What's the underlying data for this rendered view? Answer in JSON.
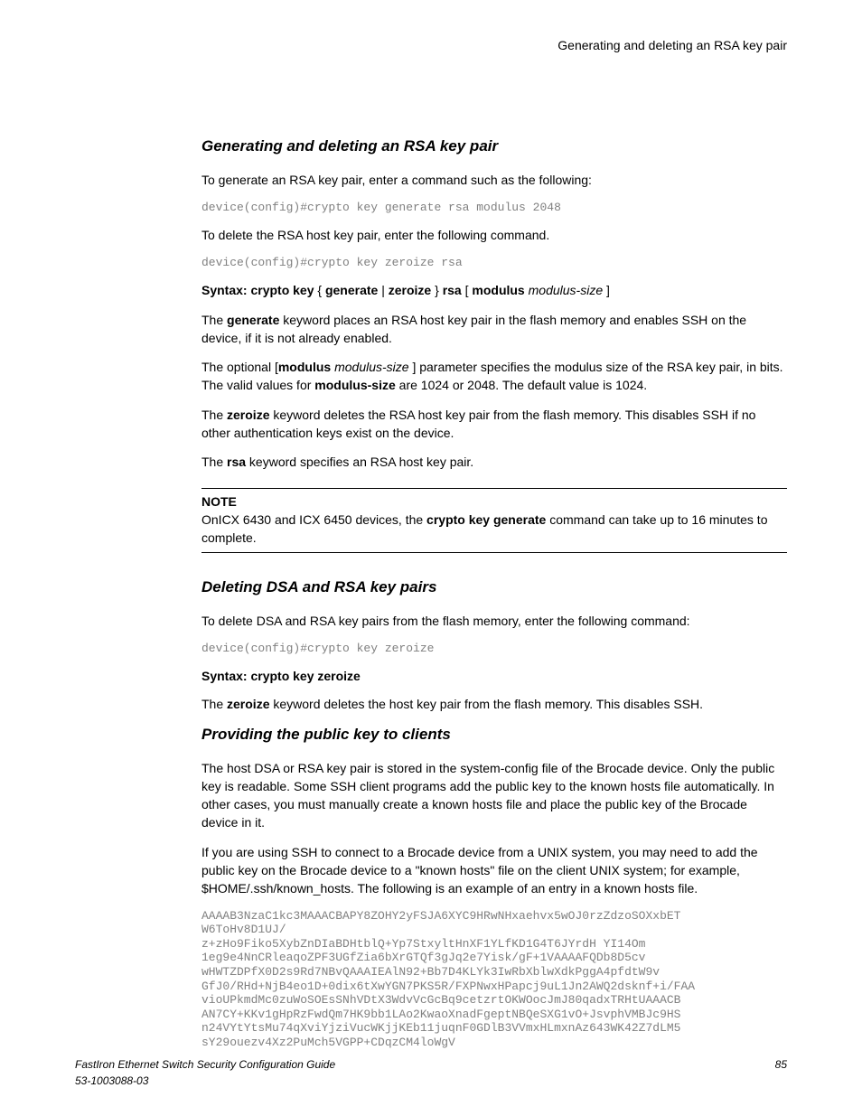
{
  "header": {
    "running": "Generating and deleting an RSA key pair"
  },
  "sections": {
    "s1": {
      "heading": "Generating and deleting an RSA key pair",
      "p1": "To generate an RSA key pair, enter a command such as the following:",
      "code1": "device(config)#crypto key generate rsa modulus 2048",
      "p2": "To delete the RSA host key pair, enter the following command.",
      "code2": "device(config)#crypto key zeroize rsa",
      "syntax_prefix": "Syntax: crypto key",
      "syntax_brace_open": " { ",
      "syntax_generate": "generate",
      "syntax_pipe": " | ",
      "syntax_zeroize": "zeroize",
      "syntax_brace_close": " } ",
      "syntax_rsa": "rsa",
      "syntax_bracket_open": " [ ",
      "syntax_modulus": "modulus",
      "syntax_space": " ",
      "syntax_modsize": "modulus-size",
      "syntax_bracket_close": " ]",
      "p3_a": "The ",
      "p3_b": "generate",
      "p3_c": " keyword places an RSA host key pair in the flash memory and enables SSH on the device, if it is not already enabled.",
      "p4_a": "The optional [",
      "p4_b": "modulus",
      "p4_c": " ",
      "p4_d": "modulus-size",
      "p4_e": " ] parameter specifies the modulus size of the RSA key pair, in bits. The valid values for ",
      "p4_f": "modulus-size",
      "p4_g": " are 1024 or 2048. The default value is 1024.",
      "p5_a": "The ",
      "p5_b": "zeroize",
      "p5_c": " keyword deletes the RSA host key pair from the flash memory. This disables SSH if no other authentication keys exist on the device.",
      "p6_a": "The ",
      "p6_b": "rsa",
      "p6_c": " keyword specifies an RSA host key pair.",
      "note_label": "NOTE",
      "note_a": "OnICX 6430 and ICX 6450 devices, the ",
      "note_b": "crypto key generate",
      "note_c": " command can take up to 16 minutes to complete."
    },
    "s2": {
      "heading": "Deleting DSA and RSA key pairs",
      "p1": "To delete DSA and RSA key pairs from the flash memory, enter the following command:",
      "code1": "device(config)#crypto key zeroize",
      "syntax": "Syntax: crypto key zeroize",
      "p2_a": "The ",
      "p2_b": "zeroize",
      "p2_c": " keyword deletes the host key pair from the flash memory. This disables SSH."
    },
    "s3": {
      "heading": "Providing the public key to clients",
      "p1": "The host DSA or RSA key pair is stored in the system-config file of the Brocade device. Only the public key is readable. Some SSH client programs add the public key to the known hosts file automatically. In other cases, you must manually create a known hosts file and place the public key of the Brocade device in it.",
      "p2": "If you are using SSH to connect to a Brocade device from a UNIX system, you may need to add the public key on the Brocade device to a \"known hosts\" file on the client UNIX system; for example, $HOME/.ssh/known_hosts. The following is an example of an entry in a known hosts file.",
      "keyblock": "AAAAB3NzaC1kc3MAAACBAPY8ZOHY2yFSJA6XYC9HRwNHxaehvx5wOJ0rzZdzoSOXxbET\nW6ToHv8D1UJ/\nz+zHo9Fiko5XybZnDIaBDHtblQ+Yp7StxyltHnXF1YLfKD1G4T6JYrdH YI14Om\n1eg9e4NnCRleaqoZPF3UGfZia6bXrGTQf3gJq2e7Yisk/gF+1VAAAAFQDb8D5cv\nwHWTZDPfX0D2s9Rd7NBvQAAAIEAlN92+Bb7D4KLYk3IwRbXblwXdkPggA4pfdtW9v\nGfJ0/RHd+NjB4eo1D+0dix6tXwYGN7PKS5R/FXPNwxHPapcj9uL1Jn2AWQ2dsknf+i/FAA\nvioUPkmdMc0zuWoSOEsSNhVDtX3WdvVcGcBq9cetzrtOKWOocJmJ80qadxTRHtUAAACB\nAN7CY+KKv1gHpRzFwdQm7HK9bb1LAo2KwaoXnadFgeptNBQeSXG1vO+JsvphVMBJc9HS\nn24VYtYtsMu74qXviYjziVucWKjjKEb11juqnF0GDlB3VVmxHLmxnAz643WK42Z7dLM5\nsY29ouezv4Xz2PuMch5VGPP+CDqzCM4loWgV"
    }
  },
  "footer": {
    "title": "FastIron Ethernet Switch Security Configuration Guide",
    "docnum": "53-1003088-03",
    "page": "85"
  }
}
